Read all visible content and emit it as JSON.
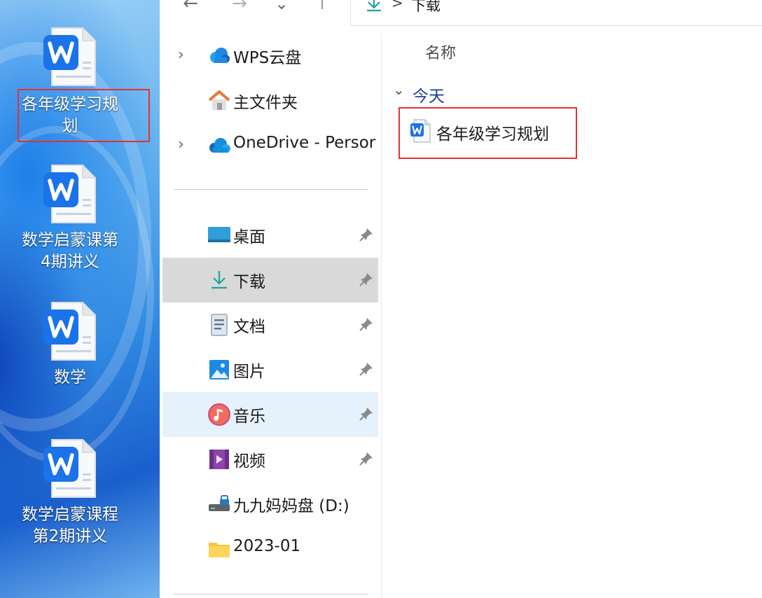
{
  "desktop": {
    "icons": [
      {
        "label_line1": "各年级学习规",
        "label_line2": "划",
        "highlighted": true
      },
      {
        "label_line1": "数学启蒙课第",
        "label_line2": "4期讲义",
        "highlighted": false
      },
      {
        "label_line1": "数学",
        "label_line2": "",
        "highlighted": false
      },
      {
        "label_line1": "数学启蒙课程",
        "label_line2": "第2期讲义",
        "highlighted": false
      }
    ],
    "icon_name": "wps-writer-doc-icon"
  },
  "toolbar": {
    "back_glyph": "←",
    "forward_glyph": "→",
    "recent_glyph": "⌄",
    "up_glyph": "↑",
    "breadcrumb_separator": ">",
    "current_folder": "下载"
  },
  "navpane": {
    "top_items": [
      {
        "label": "WPS云盘",
        "icon": "wps-cloud-icon",
        "expandable": true
      },
      {
        "label": "主文件夹",
        "icon": "home-icon",
        "expandable": false
      },
      {
        "label": "OneDrive - Persor",
        "icon": "onedrive-icon",
        "expandable": true
      }
    ],
    "quick_access": [
      {
        "label": "桌面",
        "icon": "desktop-icon",
        "pinned": true
      },
      {
        "label": "下载",
        "icon": "download-icon",
        "pinned": true,
        "state": "selected"
      },
      {
        "label": "文档",
        "icon": "documents-icon",
        "pinned": true
      },
      {
        "label": "图片",
        "icon": "pictures-icon",
        "pinned": true
      },
      {
        "label": "音乐",
        "icon": "music-icon",
        "pinned": true,
        "state": "hover"
      },
      {
        "label": "视频",
        "icon": "videos-icon",
        "pinned": true
      },
      {
        "label": "九九妈妈盘 (D:)",
        "icon": "drive-icon",
        "pinned": false
      },
      {
        "label": "2023-01",
        "icon": "folder-icon",
        "pinned": false
      }
    ]
  },
  "content": {
    "column_header": "名称",
    "group": "今天",
    "files": [
      {
        "name": "各年级学习规划",
        "icon": "wps-doc-icon",
        "highlighted": true
      }
    ]
  },
  "colors": {
    "highlight_box": "#e53030",
    "selected_bg": "#d9d9d9",
    "hover_bg": "#e5f1fb",
    "group_header": "#1d3f95",
    "wps_blue": "#1a73e8"
  }
}
